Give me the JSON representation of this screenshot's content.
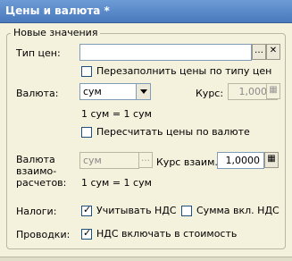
{
  "title": "Цены и валюта *",
  "group_title": "Новые значения",
  "price_type": {
    "label": "Тип цен:",
    "value": ""
  },
  "refill": {
    "label": "Перезаполнить цены по типу цен",
    "checked": false
  },
  "currency": {
    "label": "Валюта:",
    "value": "сум"
  },
  "rate": {
    "label": "Курс:",
    "value": "1,0000"
  },
  "rate_note": "1 сум = 1 сум",
  "recalc": {
    "label": "Пересчитать цены по валюте",
    "checked": false
  },
  "settle": {
    "label_lines": [
      "Валюта",
      "взаимо-",
      "расчетов:"
    ],
    "value": "сум",
    "rate_label": "Курс взаим.:",
    "rate_value": "1,0000",
    "note": "1 сум = 1 сум"
  },
  "taxes": {
    "label": "Налоги:",
    "vat_label": "Учитывать НДС",
    "vat_checked": true,
    "incl_label": "Сумма вкл. НДС",
    "incl_checked": false
  },
  "postings": {
    "label": "Проводки:",
    "cb_label": "НДС включать в стоимость",
    "checked": true
  }
}
